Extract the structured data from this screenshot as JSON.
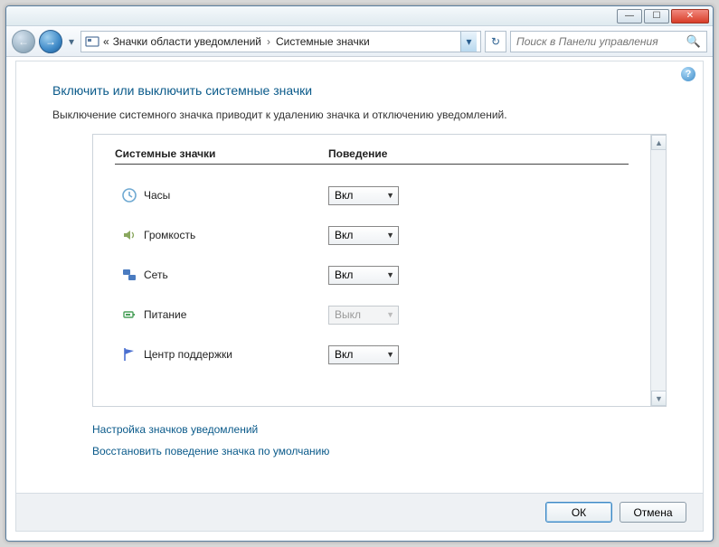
{
  "titlebar": {
    "min": "—",
    "max": "☐",
    "close": "✕"
  },
  "nav": {
    "back_glyph": "←",
    "forward_glyph": "→",
    "drop_glyph": "▾"
  },
  "address": {
    "prefix": "«",
    "crumb1": "Значки области уведомлений",
    "crumb2": "Системные значки",
    "sep": "›",
    "drop": "▾",
    "refresh": "↻"
  },
  "search": {
    "placeholder": "Поиск в Панели управления",
    "icon": "🔍"
  },
  "help_icon": "?",
  "page": {
    "title": "Включить или выключить системные значки",
    "desc": "Выключение системного значка приводит к удалению значка и отключению уведомлений."
  },
  "columns": {
    "icons": "Системные значки",
    "behavior": "Поведение"
  },
  "options": {
    "on": "Вкл",
    "off": "Выкл"
  },
  "rows": [
    {
      "key": "clock",
      "label": "Часы",
      "value": "Вкл",
      "disabled": false,
      "color": "#6fa9d2"
    },
    {
      "key": "volume",
      "label": "Громкость",
      "value": "Вкл",
      "disabled": false,
      "color": "#8aa85f"
    },
    {
      "key": "network",
      "label": "Сеть",
      "value": "Вкл",
      "disabled": false,
      "color": "#4a7bc0"
    },
    {
      "key": "power",
      "label": "Питание",
      "value": "Выкл",
      "disabled": true,
      "color": "#4aa05a"
    },
    {
      "key": "action",
      "label": "Центр поддержки",
      "value": "Вкл",
      "disabled": false,
      "color": "#4a6fd0"
    }
  ],
  "links": {
    "customize": "Настройка значков уведомлений",
    "restore": "Восстановить поведение значка по умолчанию"
  },
  "footer": {
    "ok": "ОК",
    "cancel": "Отмена"
  },
  "scroll": {
    "up": "▲",
    "down": "▼"
  }
}
